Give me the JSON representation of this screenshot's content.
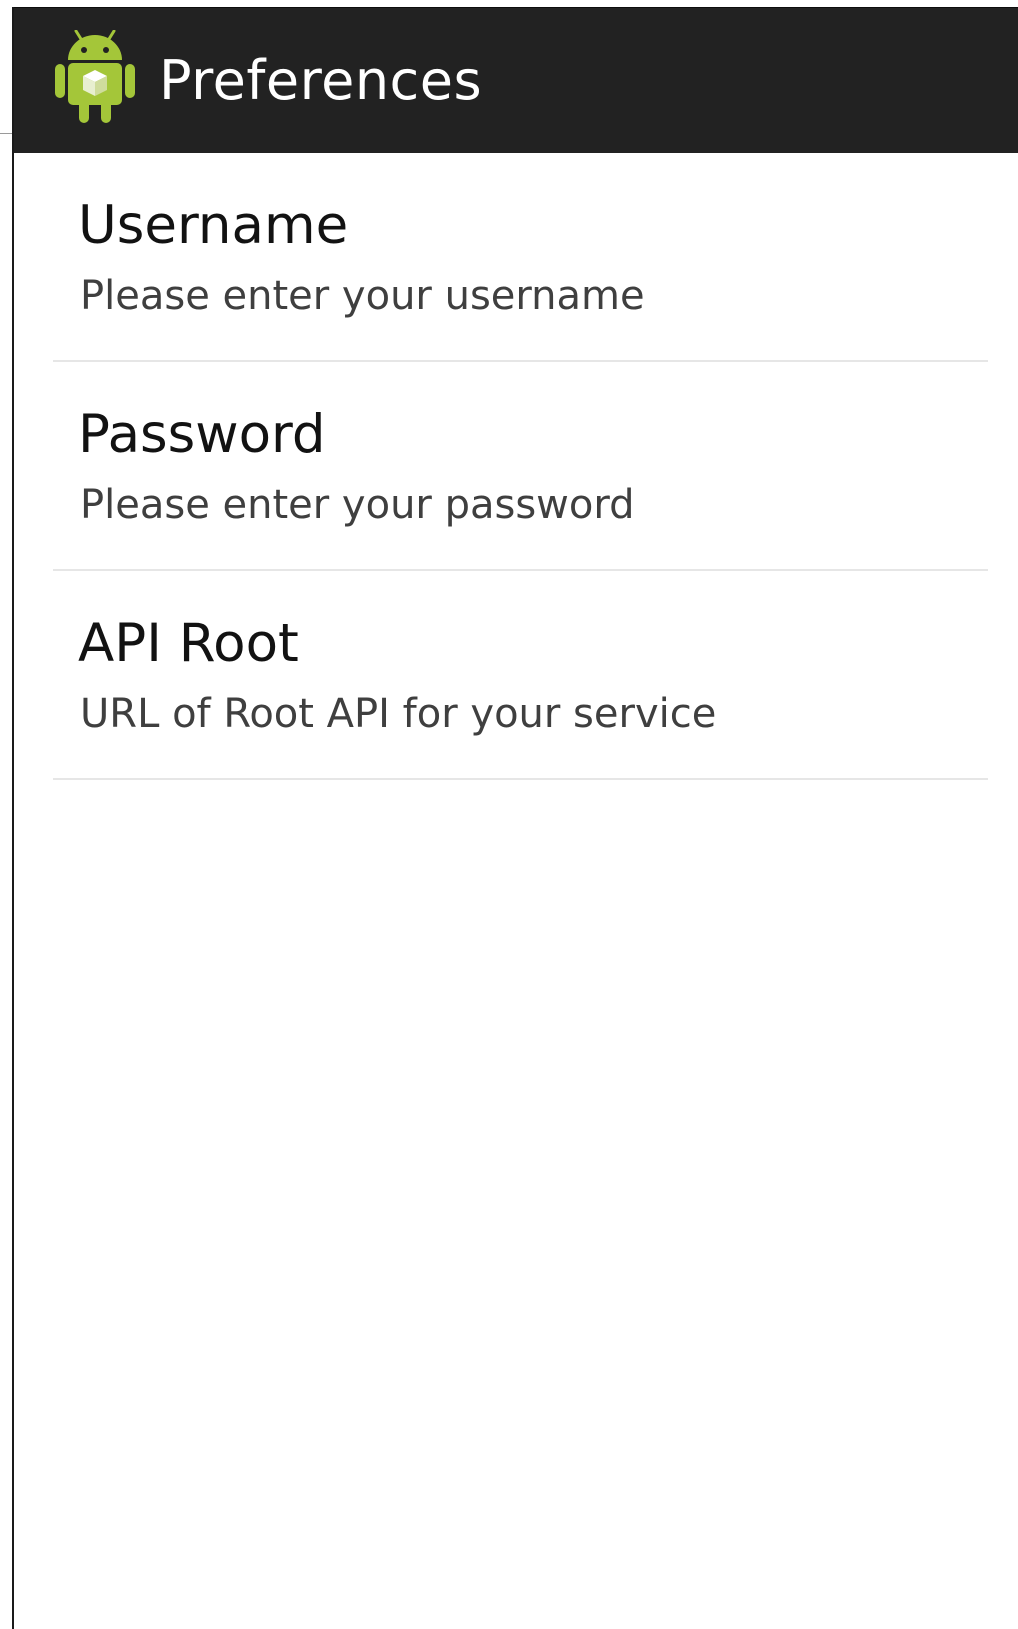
{
  "action_bar": {
    "title": "Preferences",
    "icon": "android-robot-icon"
  },
  "preferences": [
    {
      "title": "Username",
      "summary": "Please enter your username"
    },
    {
      "title": "Password",
      "summary": "Please enter your password"
    },
    {
      "title": "API Root",
      "summary": "URL of Root API for your service"
    }
  ],
  "colors": {
    "action_bar_bg": "#222222",
    "action_bar_text": "#ffffff",
    "android_green": "#a4c639",
    "title_text": "#121212",
    "summary_text": "#3f3f3f",
    "divider": "#e6e6e6"
  }
}
